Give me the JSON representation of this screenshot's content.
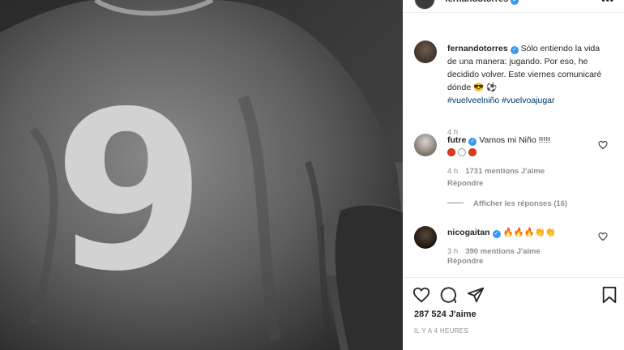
{
  "post": {
    "jersey_number": "9"
  },
  "header": {
    "username": "fernandotorres",
    "more_label": "•••"
  },
  "caption": {
    "username": "fernandotorres",
    "text": "Sólo entiendo la vida de una manera: jugando. Por eso, he decidido volver. Este viernes comunicaré dónde 😎 ⚽",
    "hashtags": "#vuelveelniño #vuelvoajugar",
    "age": "4 h"
  },
  "comments": [
    {
      "username": "futre",
      "text": "Vamos mi Niño !!!!!",
      "dots": [
        "#e03a1e",
        "#ffffff",
        "#e03a1e"
      ],
      "age": "4 h",
      "likes": "1731 mentions J'aime",
      "reply": "Répondre"
    },
    {
      "username": "nicogaitan",
      "text": "🔥🔥🔥👏👏",
      "age": "3 h",
      "likes": "390 mentions J'aime",
      "reply": "Répondre"
    }
  ],
  "view_replies": "Afficher les réponses (16)",
  "actions": {
    "likes": "287 524 J'aime",
    "time_ago": "IL Y A 4 HEURES"
  },
  "colors": {
    "verified": "#3897f0",
    "hashtag": "#00376b",
    "muted": "#8e8e8e"
  },
  "icons": [
    "heart-icon",
    "comment-icon",
    "share-icon",
    "bookmark-icon",
    "verified-badge-icon",
    "more-options-icon"
  ]
}
